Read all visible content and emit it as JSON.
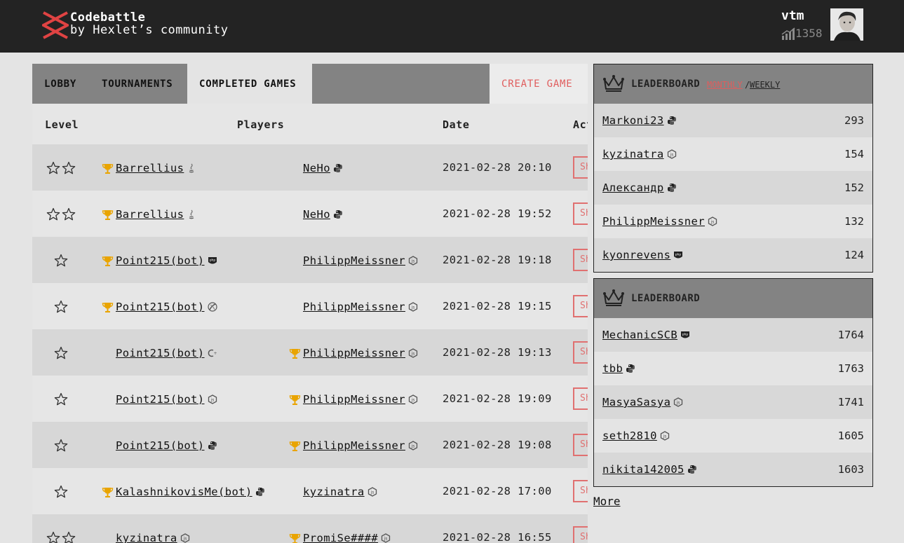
{
  "header": {
    "brand_title": "Codebattle",
    "brand_sub": "by Hexlet’s community",
    "user_name": "vtm",
    "rating": "1358"
  },
  "tabs": [
    {
      "label": "LOBBY",
      "active": false
    },
    {
      "label": "TOURNAMENTS",
      "active": false
    },
    {
      "label": "COMPLETED GAMES",
      "active": true
    }
  ],
  "create_game_label": "CREATE GAME",
  "table": {
    "columns": [
      "Level",
      "Players",
      "Date",
      "Act"
    ],
    "rows": [
      {
        "stars": 2,
        "p1": "Barrellius",
        "p1_lang": "java",
        "p1_win": true,
        "p2": "NeHo",
        "p2_lang": "python",
        "p2_win": false,
        "date": "2021-02-28 20:10",
        "action": "Sh"
      },
      {
        "stars": 2,
        "p1": "Barrellius",
        "p1_lang": "java",
        "p1_win": true,
        "p2": "NeHo",
        "p2_lang": "python",
        "p2_win": false,
        "date": "2021-02-28 19:52",
        "action": "Sh"
      },
      {
        "stars": 1,
        "p1": "Point215(bot)",
        "p1_lang": "php",
        "p1_win": true,
        "p2": "PhilippMeissner",
        "p2_lang": "node",
        "p2_win": false,
        "date": "2021-02-28 19:18",
        "action": "Sh"
      },
      {
        "stars": 1,
        "p1": "Point215(bot)",
        "p1_lang": "clojure",
        "p1_win": true,
        "p2": "PhilippMeissner",
        "p2_lang": "node",
        "p2_win": false,
        "date": "2021-02-28 19:15",
        "action": "Sh"
      },
      {
        "stars": 1,
        "p1": "Point215(bot)",
        "p1_lang": "cpp",
        "p1_win": false,
        "p2": "PhilippMeissner",
        "p2_lang": "node",
        "p2_win": true,
        "date": "2021-02-28 19:13",
        "action": "Sh"
      },
      {
        "stars": 1,
        "p1": "Point215(bot)",
        "p1_lang": "node",
        "p1_win": false,
        "p2": "PhilippMeissner",
        "p2_lang": "node",
        "p2_win": true,
        "date": "2021-02-28 19:09",
        "action": "Sh"
      },
      {
        "stars": 1,
        "p1": "Point215(bot)",
        "p1_lang": "python",
        "p1_win": false,
        "p2": "PhilippMeissner",
        "p2_lang": "node",
        "p2_win": true,
        "date": "2021-02-28 19:08",
        "action": "Sh"
      },
      {
        "stars": 1,
        "p1": "KalashnikovisMe(bot)",
        "p1_lang": "python",
        "p1_win": true,
        "p2": "kyzinatra",
        "p2_lang": "node",
        "p2_win": false,
        "date": "2021-02-28 17:00",
        "action": "Sh"
      },
      {
        "stars": 2,
        "p1": "kyzinatra",
        "p1_lang": "node",
        "p1_win": false,
        "p2": "PromiSe####",
        "p2_lang": "node",
        "p2_win": true,
        "date": "2021-02-28 16:55",
        "action": "Sh"
      }
    ]
  },
  "leaderboard_period": {
    "title": "LEADERBOARD",
    "monthly": "MONTHLY",
    "separator": "/",
    "weekly": "WEEKLY",
    "entries": [
      {
        "name": "Markoni23",
        "lang": "python",
        "score": "293"
      },
      {
        "name": "kyzinatra",
        "lang": "node",
        "score": "154"
      },
      {
        "name": "Александр",
        "lang": "python",
        "score": "152"
      },
      {
        "name": "PhilippMeissner",
        "lang": "node",
        "score": "132"
      },
      {
        "name": "kyonrevens",
        "lang": "php",
        "score": "124"
      }
    ]
  },
  "leaderboard_total": {
    "title": "LEADERBOARD",
    "entries": [
      {
        "name": "MechanicSCB",
        "lang": "php",
        "score": "1764"
      },
      {
        "name": "tbb",
        "lang": "python",
        "score": "1763"
      },
      {
        "name": "MasyaSasya",
        "lang": "node",
        "score": "1741"
      },
      {
        "name": "seth2810",
        "lang": "node",
        "score": "1605"
      },
      {
        "name": "nikita142005",
        "lang": "python",
        "score": "1603"
      }
    ]
  },
  "more_label": "More",
  "colors": {
    "accent": "#e05d5d",
    "header_bg": "#232323",
    "tab_bg": "#838383"
  }
}
